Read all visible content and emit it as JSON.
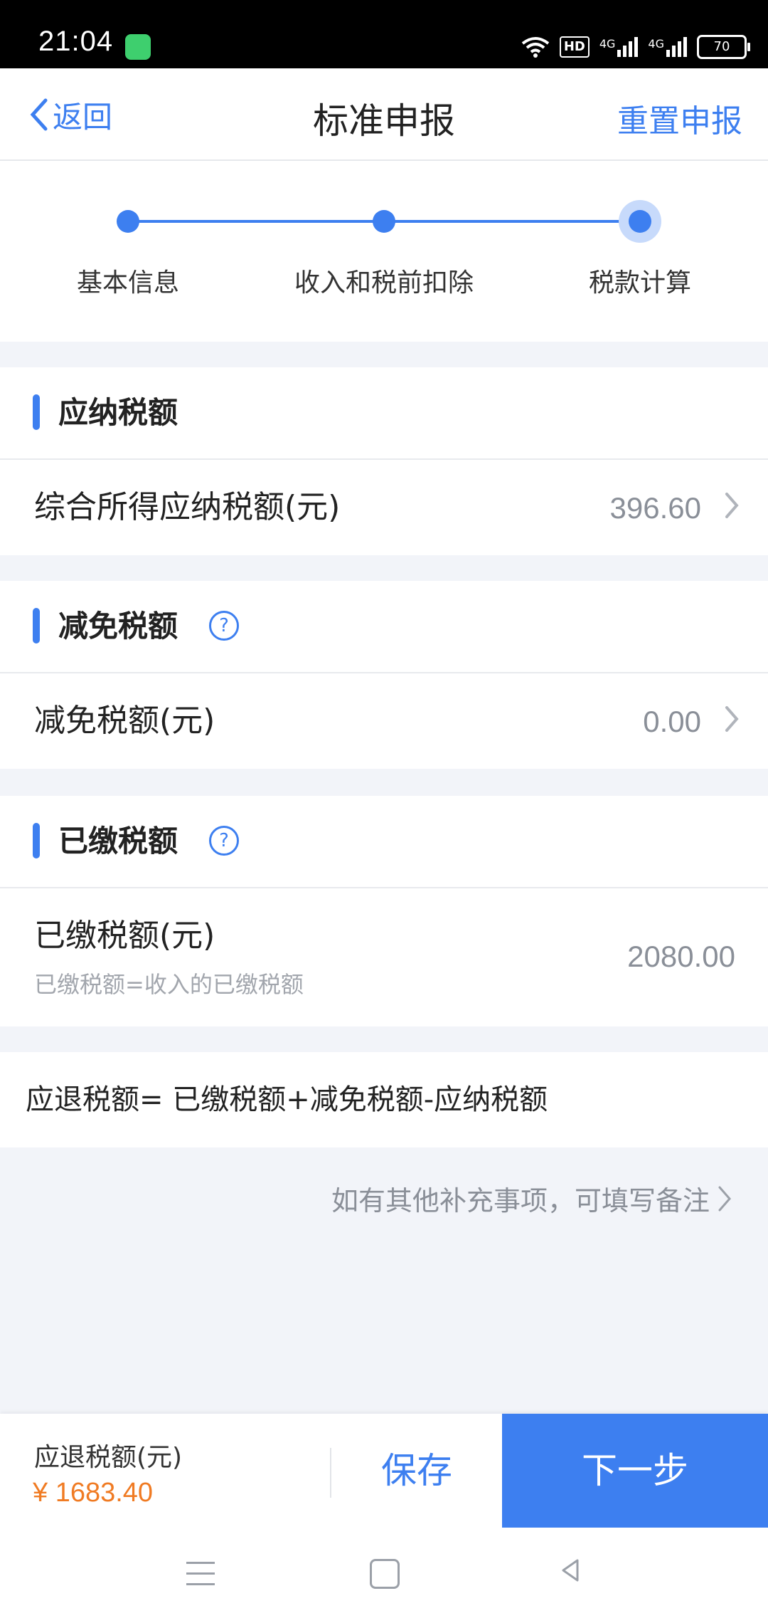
{
  "status_bar": {
    "time": "21:04",
    "network_badge": "HD",
    "signal_1": "4G",
    "signal_2": "4G",
    "battery": "70"
  },
  "nav": {
    "back_label": "返回",
    "title": "标准申报",
    "reset_label": "重置申报"
  },
  "stepper": {
    "steps": [
      {
        "label": "基本信息"
      },
      {
        "label": "收入和税前扣除"
      },
      {
        "label": "税款计算"
      }
    ],
    "active_index": 2
  },
  "sections": {
    "payable": {
      "title": "应纳税额",
      "row_label": "综合所得应纳税额(元)",
      "row_value": "396.60"
    },
    "reduction": {
      "title": "减免税额",
      "row_label": "减免税额(元)",
      "row_value": "0.00"
    },
    "paid": {
      "title": "已缴税额",
      "row_label": "已缴税额(元)",
      "row_sub": "已缴税额=收入的已缴税额",
      "row_value": "2080.00"
    }
  },
  "formula": "应退税额= 已缴税额+减免税额-应纳税额",
  "remark_link": "如有其他补充事项，可填写备注",
  "bottom_bar": {
    "refund_label": "应退税额(元)",
    "refund_amount": "¥ 1683.40",
    "save_label": "保存",
    "next_label": "下一步"
  },
  "colors": {
    "accent": "#3d7ff0",
    "amount": "#f07b23"
  }
}
